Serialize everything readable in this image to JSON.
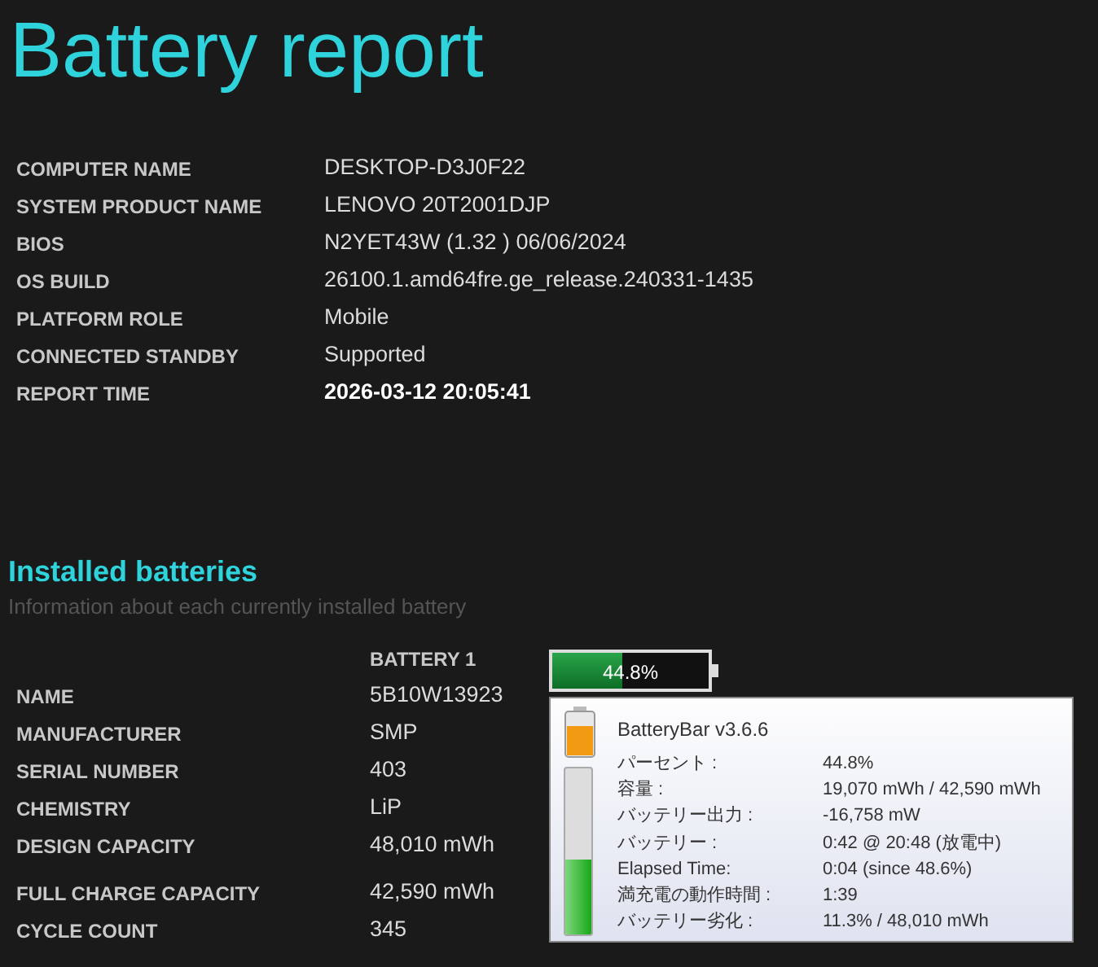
{
  "title": "Battery report",
  "system_info": [
    {
      "label": "COMPUTER NAME",
      "value": "DESKTOP-D3J0F22",
      "emphasis": false
    },
    {
      "label": "SYSTEM PRODUCT NAME",
      "value": "LENOVO 20T2001DJP",
      "emphasis": false
    },
    {
      "label": "BIOS",
      "value": "N2YET43W (1.32 ) 06/06/2024",
      "emphasis": false
    },
    {
      "label": "OS BUILD",
      "value": "26100.1.amd64fre.ge_release.240331-1435",
      "emphasis": false
    },
    {
      "label": "PLATFORM ROLE",
      "value": "Mobile",
      "emphasis": false
    },
    {
      "label": "CONNECTED STANDBY",
      "value": "Supported",
      "emphasis": false
    },
    {
      "label": "REPORT TIME",
      "value": "2026-03-12  20:05:41",
      "emphasis": true
    }
  ],
  "installed_batteries": {
    "heading": "Installed batteries",
    "description": "Information about each currently installed battery",
    "column_header": "BATTERY 1",
    "rows": [
      {
        "label": "NAME",
        "value": "5B10W13923"
      },
      {
        "label": "MANUFACTURER",
        "value": "SMP"
      },
      {
        "label": "SERIAL NUMBER",
        "value": "403"
      },
      {
        "label": "CHEMISTRY",
        "value": "LiP"
      },
      {
        "label": "DESIGN CAPACITY",
        "value": "48,010 mWh"
      },
      {
        "label": "FULL CHARGE CAPACITY",
        "value": "42,590 mWh"
      },
      {
        "label": "CYCLE COUNT",
        "value": "345"
      }
    ]
  },
  "battery_bar": {
    "text": "44.8%",
    "level": 0.448
  },
  "tooltip": {
    "title": "BatteryBar v3.6.6",
    "level": 0.448,
    "rows": [
      {
        "label": "パーセント :",
        "value": "44.8%"
      },
      {
        "label": "容量 :",
        "value": "19,070 mWh / 42,590 mWh"
      },
      {
        "label": "バッテリー出力 :",
        "value": "-16,758 mW"
      },
      {
        "label": "バッテリー :",
        "value": "0:42 @ 20:48 (放電中)"
      },
      {
        "label": "Elapsed Time:",
        "value": "0:04 (since 48.6%)"
      },
      {
        "label": "満充電の動作時間 :",
        "value": "1:39"
      },
      {
        "label": "バッテリー劣化 :",
        "value": "11.3% / 48,010 mWh"
      }
    ]
  }
}
